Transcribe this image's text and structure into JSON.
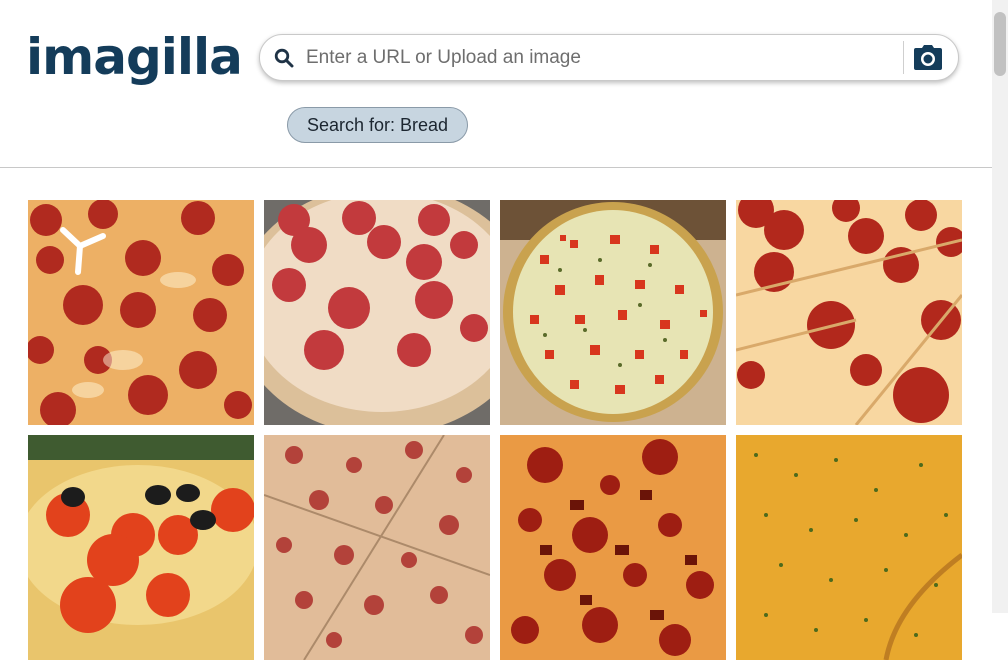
{
  "brand": {
    "logo_text": "imagilla",
    "color": "#143c5a"
  },
  "search": {
    "placeholder": "Enter a URL or Upload an image",
    "value": "",
    "search_icon": "search-icon",
    "camera_icon": "camera-icon"
  },
  "suggestion": {
    "label": "Search for: Bread"
  },
  "results": {
    "items": [
      {
        "name": "pepperoni-pizza-closeup-with-table-tripod",
        "alt": "pepperoni pizza"
      },
      {
        "name": "pepperoni-pizza-whole",
        "alt": "pepperoni pizza"
      },
      {
        "name": "tomato-feta-pizza-in-box",
        "alt": "tomato pizza"
      },
      {
        "name": "pepperoni-pizza-slices",
        "alt": "pepperoni pizza"
      },
      {
        "name": "tomato-olive-pizza",
        "alt": "tomato olive pizza"
      },
      {
        "name": "cheese-pepperoni-pizza-bits",
        "alt": "pizza"
      },
      {
        "name": "pepperoni-loaded-pizza",
        "alt": "pepperoni pizza"
      },
      {
        "name": "cheesy-herb-pizza",
        "alt": "cheese pizza"
      }
    ]
  }
}
